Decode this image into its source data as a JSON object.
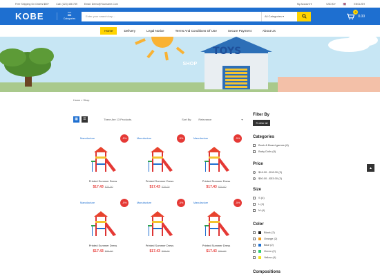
{
  "topbar": {
    "shipping": "Free Shipping On Orders $50+",
    "phone": "Call: (123) 456 789",
    "email": "Email: Demo@Yourname.Com",
    "account": "My Account",
    "currency": "USD $",
    "language": "ENGLISH"
  },
  "header": {
    "logo": "KOBE",
    "categories_label": "Categories",
    "search_placeholder": "Enter your search key ...",
    "category_select": "All Categories",
    "cart_count": "0",
    "cart_total": "0.00"
  },
  "nav": [
    "Home",
    "Delivery",
    "Legal Notice",
    "Terms And Conditions Of Use",
    "Secure Payment",
    "About Us"
  ],
  "banner": {
    "title": "SHOP",
    "sign_text": "TOYS"
  },
  "breadcrumb": "Home > Shop",
  "toolbar": {
    "count_text": "There Are 13 Products.",
    "sort_label": "Sort By:",
    "sort_value": "Relevance"
  },
  "products": [
    {
      "maker": "Manufacture",
      "discount": "-5%",
      "name": "Printed Summer Dress",
      "price": "$17.43",
      "old_price": "$20.00"
    },
    {
      "maker": "Manufacture",
      "discount": "-5%",
      "name": "Printed Summer Dress",
      "price": "$17.43",
      "old_price": "$20.00"
    },
    {
      "maker": "Manufacture",
      "discount": "-5%",
      "name": "Printed Summer Dress",
      "price": "$17.43",
      "old_price": "$20.00"
    },
    {
      "maker": "Manufacture",
      "discount": "-5%",
      "name": "Printed Summer Dress",
      "price": "$17.43",
      "old_price": "$20.00"
    },
    {
      "maker": "Manufacture",
      "discount": "-5%",
      "name": "Printed Summer Dress",
      "price": "$17.43",
      "old_price": "$20.00"
    },
    {
      "maker": "Manufacture",
      "discount": "-5%",
      "name": "Printed Summer Dress",
      "price": "$17.43",
      "old_price": "$20.00"
    }
  ],
  "filters": {
    "title": "Filter By",
    "clear": "clear all",
    "categories": {
      "title": "Categories",
      "items": [
        "Book & Board games (8)",
        "Baby Dolls (8)"
      ]
    },
    "price": {
      "title": "Price",
      "items": [
        "$16.00 - $18.00 (3)",
        "$50.00 - $53.00 (3)"
      ]
    },
    "size": {
      "title": "Size",
      "items": [
        "S (4)",
        "L (4)",
        "M (4)"
      ]
    },
    "color": {
      "title": "Color",
      "items": [
        {
          "label": "Black (2)",
          "hex": "#222222"
        },
        {
          "label": "Orange (2)",
          "hex": "#f39c12"
        },
        {
          "label": "Blue (2)",
          "hex": "#1e6fd0"
        },
        {
          "label": "Green (2)",
          "hex": "#2ecc71"
        },
        {
          "label": "Yellow (4)",
          "hex": "#f1e21a"
        }
      ]
    },
    "compositions": {
      "title": "Compositions"
    }
  },
  "colors": {
    "brand": "#1e6fd0",
    "accent": "#ffd400",
    "sale": "#e53935"
  }
}
